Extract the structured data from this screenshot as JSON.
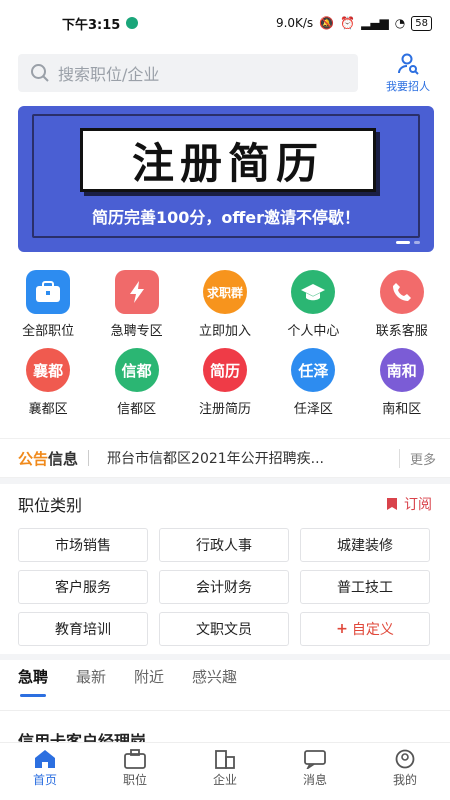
{
  "status_bar": {
    "time": "下午3:15",
    "speed": "9.0K/s",
    "battery": "58"
  },
  "search": {
    "placeholder": "搜索职位/企业"
  },
  "header": {
    "recruit_label": "我要招人"
  },
  "banner": {
    "title": "注册简历",
    "subtitle": "简历完善100分，offer邀请不停歇！"
  },
  "grid": {
    "row1": [
      {
        "label": "全部职位",
        "icon": "briefcase-icon",
        "color": "#2d8cf0",
        "glyph": ""
      },
      {
        "label": "急聘专区",
        "icon": "lightning-icon",
        "color": "#f06a6a",
        "glyph": ""
      },
      {
        "label": "立即加入",
        "icon": "join-group-icon",
        "color": "#f7941d",
        "glyph": "求职群"
      },
      {
        "label": "个人中心",
        "icon": "graduation-cap-icon",
        "color": "#2bb673",
        "glyph": ""
      },
      {
        "label": "联系客服",
        "icon": "phone-icon",
        "color": "#f26b6b",
        "glyph": ""
      }
    ],
    "row2": [
      {
        "label": "襄都区",
        "icon": "xiangdu-icon",
        "color": "#f05a4f",
        "glyph": "襄都"
      },
      {
        "label": "信都区",
        "icon": "xindu-icon",
        "color": "#2bb673",
        "glyph": "信都"
      },
      {
        "label": "注册简历",
        "icon": "resume-icon",
        "color": "#ef3b47",
        "glyph": "简历"
      },
      {
        "label": "任泽区",
        "icon": "renze-icon",
        "color": "#2d8cf0",
        "glyph": "任泽"
      },
      {
        "label": "南和区",
        "icon": "nanhe-icon",
        "color": "#7b5cd6",
        "glyph": "南和"
      }
    ]
  },
  "notice": {
    "tag_a": "公告",
    "tag_b": "信息",
    "text": "邢台市信都区2021年公开招聘疾...",
    "more": "更多"
  },
  "categories": {
    "title": "职位类别",
    "subscribe": "订阅",
    "items": [
      "市场销售",
      "行政人事",
      "城建装修",
      "客户服务",
      "会计财务",
      "普工技工",
      "教育培训",
      "文职文员",
      "自定义"
    ]
  },
  "tabs": [
    "急聘",
    "最新",
    "附近",
    "感兴趣"
  ],
  "peek_text": "信用卡客户经理岗",
  "nav": [
    "首页",
    "职位",
    "企业",
    "消息",
    "我的"
  ],
  "colors": {
    "accent": "#2c6fe0",
    "banner": "#4a5fd3",
    "subscribe": "#d9434b",
    "notice_tag": "#f08a1c"
  }
}
